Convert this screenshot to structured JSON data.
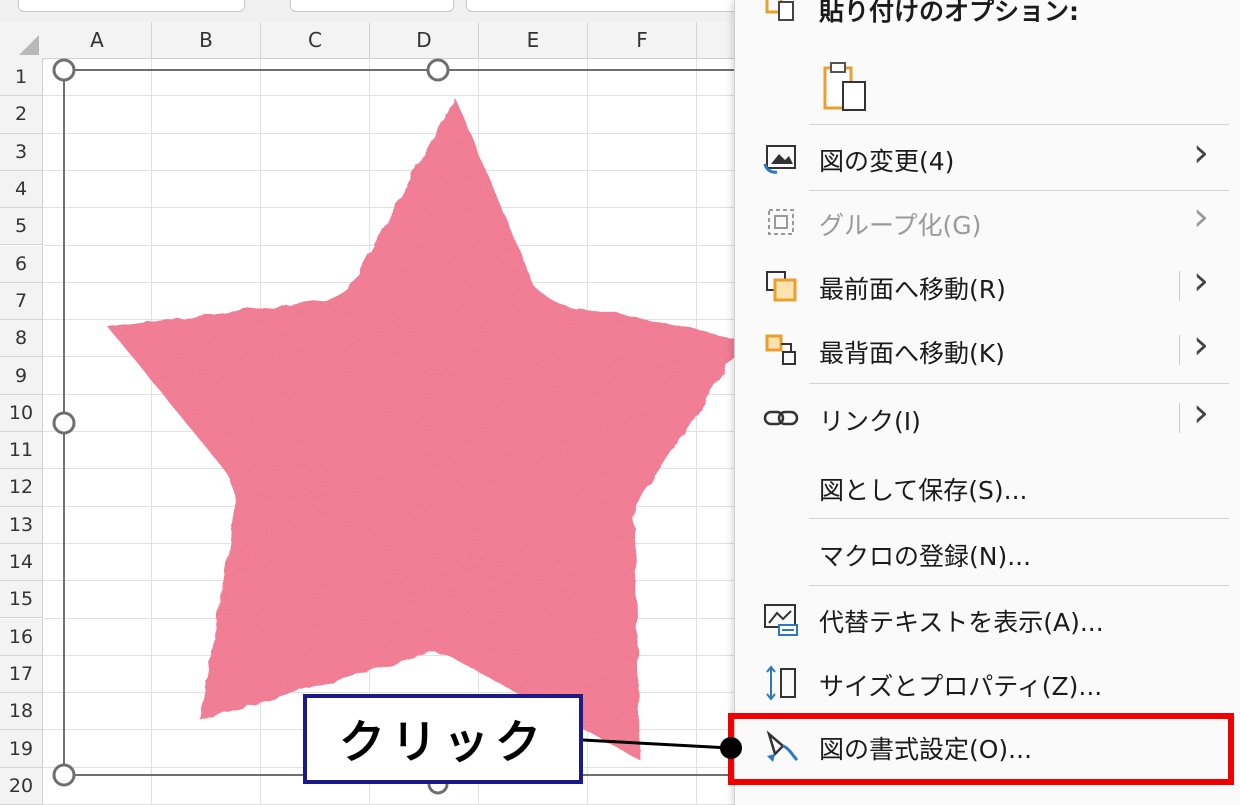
{
  "sheet": {
    "columns": [
      "A",
      "B",
      "C",
      "D",
      "E",
      "F"
    ],
    "rows": [
      "1",
      "2",
      "3",
      "4",
      "5",
      "6",
      "7",
      "8",
      "9",
      "10",
      "11",
      "12",
      "13",
      "14",
      "15",
      "16",
      "17",
      "18",
      "19",
      "20"
    ]
  },
  "shape": {
    "fill": "#f07890",
    "description_icon": "pink-star-shape"
  },
  "menu": {
    "paste_options_label": "貼り付けのオプション:",
    "items": [
      {
        "label": "図の変更(4)",
        "icon": "change-picture-icon",
        "submenu": true,
        "split": false,
        "disabled": false
      },
      {
        "label": "グループ化(G)",
        "icon": "group-icon",
        "submenu": true,
        "split": false,
        "disabled": true
      },
      {
        "label": "最前面へ移動(R)",
        "icon": "bring-to-front-icon",
        "submenu": true,
        "split": true,
        "disabled": false
      },
      {
        "label": "最背面へ移動(K)",
        "icon": "send-to-back-icon",
        "submenu": true,
        "split": true,
        "disabled": false
      },
      {
        "label": "リンク(I)",
        "icon": "link-icon",
        "submenu": true,
        "split": true,
        "disabled": false
      },
      {
        "label": "図として保存(S)...",
        "icon": "",
        "submenu": false,
        "split": false,
        "disabled": false
      },
      {
        "label": "マクロの登録(N)...",
        "icon": "",
        "submenu": false,
        "split": false,
        "disabled": false
      },
      {
        "label": "代替テキストを表示(A)...",
        "icon": "alt-text-icon",
        "submenu": false,
        "split": false,
        "disabled": false
      },
      {
        "label": "サイズとプロパティ(Z)...",
        "icon": "size-properties-icon",
        "submenu": false,
        "split": false,
        "disabled": false
      },
      {
        "label": "図の書式設定(O)...",
        "icon": "format-picture-icon",
        "submenu": false,
        "split": false,
        "disabled": false
      }
    ]
  },
  "callout": {
    "text": "クリック"
  },
  "colors": {
    "highlight": "#f00000",
    "callout_border": "#1a1a8c",
    "accent_orange": "#e8a030",
    "accent_blue": "#2a78c8"
  }
}
